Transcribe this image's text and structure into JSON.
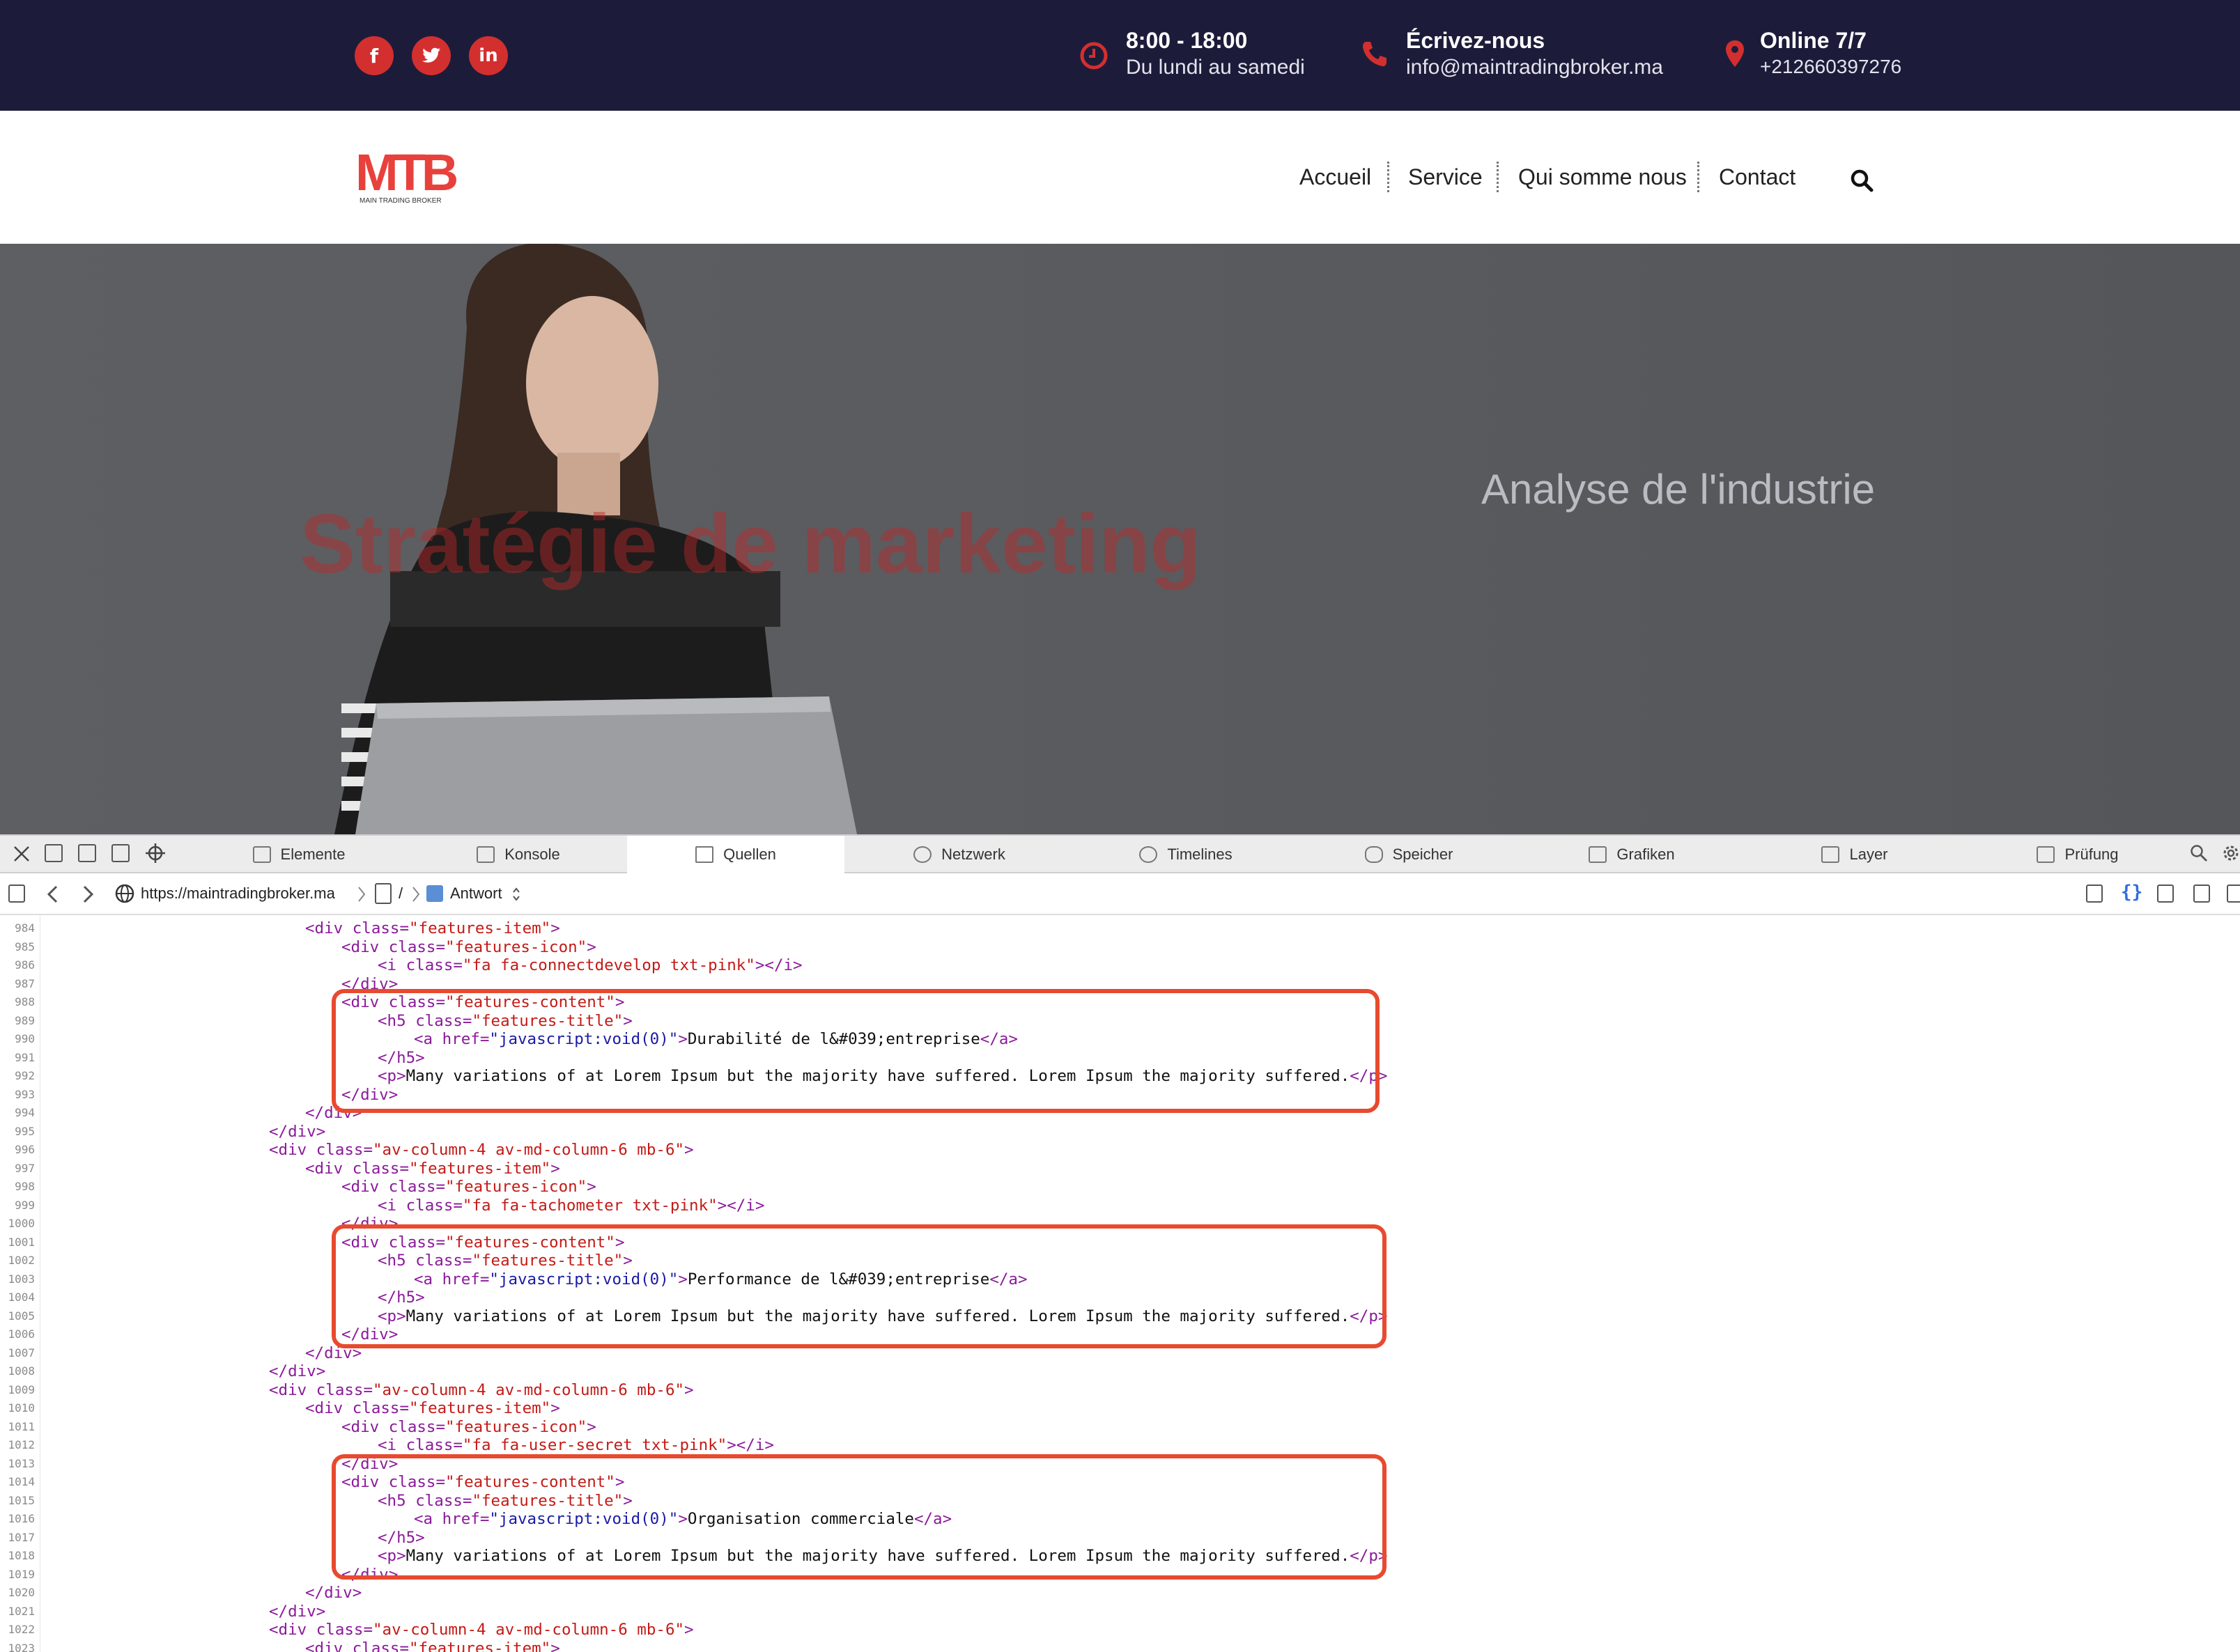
{
  "topbar": {
    "social": [
      {
        "name": "facebook-button",
        "glyph": "f"
      },
      {
        "name": "twitter-button",
        "glyph": "t"
      },
      {
        "name": "linkedin-button",
        "glyph": "in"
      }
    ],
    "hours_title": "8:00 - 18:00",
    "hours_sub": "Du lundi au samedi",
    "contact_title": "Écrivez-nous",
    "contact_sub": "info@maintradingbroker.ma",
    "online_title": "Online 7/7",
    "online_sub": "+212660397276",
    "accent_color": "#d32f2f",
    "background_color": "#1c1c3a"
  },
  "nav": {
    "logo_mark": "MTB",
    "logo_sub": "MAIN TRADING BROKER",
    "items": [
      "Accueil",
      "Service",
      "Qui somme nous",
      "Contact"
    ],
    "search_icon": "search-icon"
  },
  "hero": {
    "left_text": "Stratégie de marketing",
    "right_text": "Analyse de l'industrie"
  },
  "devtools": {
    "tabs": [
      "Elemente",
      "Konsole",
      "Quellen",
      "Netzwerk",
      "Timelines",
      "Speicher",
      "Grafiken",
      "Layer",
      "Prüfung"
    ],
    "active_tab": "Quellen",
    "path_url": "https://maintradingbroker.ma",
    "path_sep": "/",
    "path_response": "Antwort",
    "line_numbers": [
      "984",
      "985",
      "986",
      "987",
      "988",
      "989",
      "990",
      "991",
      "992",
      "993",
      "994",
      "995",
      "996",
      "997",
      "998",
      "999",
      "1000",
      "1001",
      "1002",
      "1003",
      "1004",
      "1005",
      "1006",
      "1007",
      "1008",
      "1009",
      "1010",
      "1011",
      "1012",
      "1013",
      "1014",
      "1015",
      "1016",
      "1017",
      "1018",
      "1019",
      "1020",
      "1021",
      "1022",
      "1023"
    ],
    "feature_titles": [
      "Durabilité de l&#039;entreprise",
      "Performance de l&#039;entreprise",
      "Organisation commerciale"
    ],
    "feature_icons": [
      "fa fa-connectdevelop txt-pink",
      "fa fa-tachometer txt-pink",
      "fa fa-user-secret txt-pink"
    ],
    "feature_text": "Many variations of at Lorem Ipsum but the majority have suffered. Lorem Ipsum the majority suffered.",
    "column_class": "av-column-4 av-md-column-6 mb-6",
    "highlight_color": "#e84a2f"
  }
}
